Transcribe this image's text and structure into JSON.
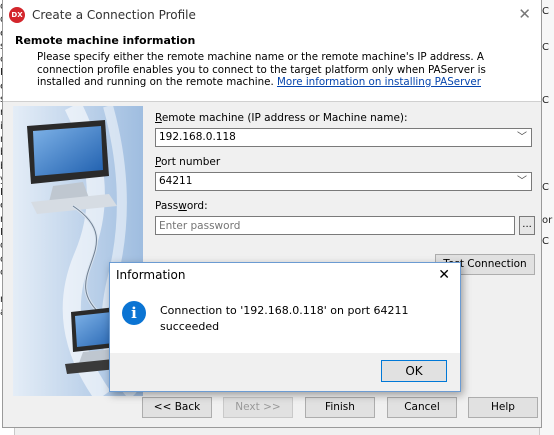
{
  "bg_left_lines": [
    "o",
    "d",
    "er",
    "ss",
    "ct",
    "R",
    "e",
    "si",
    "re",
    "ity",
    "ni",
    "b",
    "b",
    "yp",
    "D",
    "ev",
    "re",
    "M",
    "or",
    "ot",
    "ce",
    "",
    "ru",
    "ay"
  ],
  "bg_right_letters": [
    "C",
    "C",
    "C",
    "C",
    "or",
    "C"
  ],
  "dialog": {
    "icon_text": "DX",
    "title": "Create a Connection Profile",
    "header_title": "Remote machine information",
    "header_desc": "Please specify either the remote machine name or the remote machine's IP address. A connection profile enables you to connect to the target platform only when PAServer is installed and running on the remote machine.",
    "header_link": "More information on installing PAServer"
  },
  "form": {
    "remote_label_first": "R",
    "remote_label_rest": "emote machine (IP address or Machine name):",
    "remote_value": "192.168.0.118",
    "port_label_first": "P",
    "port_label_rest": "ort number",
    "port_value": "64211",
    "password_label_pre": "Pass",
    "password_label_u": "w",
    "password_label_post": "ord:",
    "password_placeholder": "Enter password",
    "browse_label": "...",
    "test_connection_label": "Test Connection"
  },
  "nav": {
    "back_label": "<< Back",
    "next_label": "Next >>",
    "finish_label": "Finish",
    "cancel_label": "Cancel",
    "help_label": "Help"
  },
  "info_dialog": {
    "title": "Information",
    "icon_glyph": "i",
    "message": "Connection to '192.168.0.118' on port 64211 succeeded",
    "ok_label": "OK"
  },
  "colors": {
    "accent": "#0078d7",
    "link": "#0645ad",
    "brand_red": "#d3262c",
    "info_blue": "#0b74d3"
  }
}
